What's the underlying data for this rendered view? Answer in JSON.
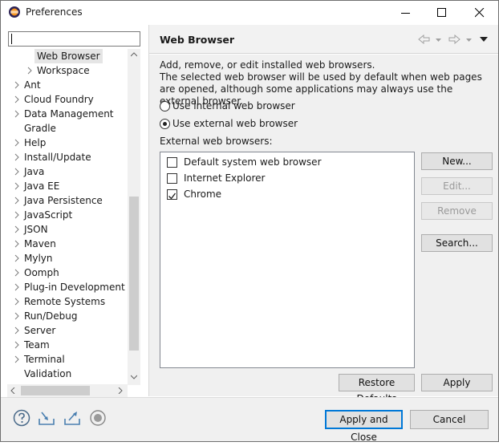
{
  "window": {
    "title": "Preferences",
    "controls": [
      "minimize-icon",
      "maximize-icon",
      "close-icon"
    ]
  },
  "filter": {
    "value": "",
    "placeholder": ""
  },
  "tree": {
    "items": [
      {
        "label": "Web Browser",
        "indent": 2,
        "expander": false,
        "selected": true
      },
      {
        "label": "Workspace",
        "indent": 2,
        "expander": true,
        "selected": false
      },
      {
        "label": "Ant",
        "indent": 1,
        "expander": true,
        "selected": false
      },
      {
        "label": "Cloud Foundry",
        "indent": 1,
        "expander": true,
        "selected": false
      },
      {
        "label": "Data Management",
        "indent": 1,
        "expander": true,
        "selected": false
      },
      {
        "label": "Gradle",
        "indent": 1,
        "expander": false,
        "selected": false
      },
      {
        "label": "Help",
        "indent": 1,
        "expander": true,
        "selected": false
      },
      {
        "label": "Install/Update",
        "indent": 1,
        "expander": true,
        "selected": false
      },
      {
        "label": "Java",
        "indent": 1,
        "expander": true,
        "selected": false
      },
      {
        "label": "Java EE",
        "indent": 1,
        "expander": true,
        "selected": false
      },
      {
        "label": "Java Persistence",
        "indent": 1,
        "expander": true,
        "selected": false
      },
      {
        "label": "JavaScript",
        "indent": 1,
        "expander": true,
        "selected": false
      },
      {
        "label": "JSON",
        "indent": 1,
        "expander": true,
        "selected": false
      },
      {
        "label": "Maven",
        "indent": 1,
        "expander": true,
        "selected": false
      },
      {
        "label": "Mylyn",
        "indent": 1,
        "expander": true,
        "selected": false
      },
      {
        "label": "Oomph",
        "indent": 1,
        "expander": true,
        "selected": false
      },
      {
        "label": "Plug-in Development",
        "indent": 1,
        "expander": true,
        "selected": false
      },
      {
        "label": "Remote Systems",
        "indent": 1,
        "expander": true,
        "selected": false
      },
      {
        "label": "Run/Debug",
        "indent": 1,
        "expander": true,
        "selected": false
      },
      {
        "label": "Server",
        "indent": 1,
        "expander": true,
        "selected": false
      },
      {
        "label": "Team",
        "indent": 1,
        "expander": true,
        "selected": false
      },
      {
        "label": "Terminal",
        "indent": 1,
        "expander": true,
        "selected": false
      },
      {
        "label": "Validation",
        "indent": 1,
        "expander": false,
        "selected": false
      }
    ]
  },
  "page": {
    "title": "Web Browser",
    "nav_icons": [
      "back-arrow-icon",
      "forward-arrow-icon",
      "view-menu-icon"
    ],
    "description": "Add, remove, or edit installed web browsers.\nThe selected web browser will be used by default when web pages are opened, although some applications may always use the external browser.",
    "radio_internal": "Use internal web browser",
    "radio_external": "Use external web browser",
    "selected_mode": "external",
    "browsers_label": "External web browsers:",
    "browsers": [
      {
        "name": "Default system web browser",
        "checked": false
      },
      {
        "name": "Internet Explorer",
        "checked": false
      },
      {
        "name": "Chrome",
        "checked": true
      }
    ],
    "buttons": {
      "new": "New...",
      "edit": "Edit...",
      "remove": "Remove",
      "search": "Search...",
      "restore_defaults": "Restore Defaults",
      "apply": "Apply"
    }
  },
  "footer": {
    "icons": [
      "help-icon",
      "import-icon",
      "export-icon",
      "record-icon"
    ],
    "apply_close": "Apply and Close",
    "cancel": "Cancel"
  }
}
